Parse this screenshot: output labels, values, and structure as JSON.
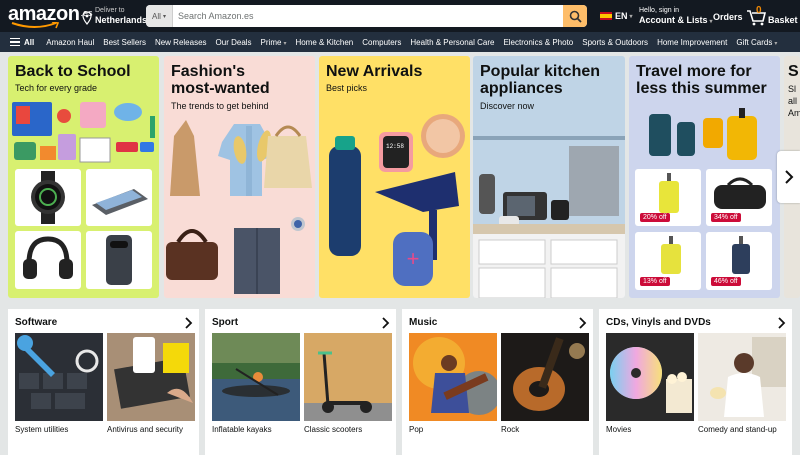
{
  "header": {
    "logo_text": "amazon",
    "logo_tld": ".es",
    "deliver_line1": "Deliver to",
    "deliver_line2": "Netherlands",
    "search_category": "All",
    "search_placeholder": "Search Amazon.es",
    "language": "EN",
    "account_line1": "Hello, sign in",
    "account_line2": "Account & Lists",
    "orders": "Orders",
    "cart_count": "0",
    "cart_label": "Basket"
  },
  "nav": {
    "all_label": "All",
    "items": [
      "Amazon Haul",
      "Best Sellers",
      "New Releases",
      "Our Deals",
      "Prime",
      "Home & Kitchen",
      "Computers",
      "Health & Personal Care",
      "Electronics & Photo",
      "Sports & Outdoors",
      "Home Improvement",
      "Gift Cards"
    ]
  },
  "hero": {
    "card1": {
      "title": "Back to School",
      "subtitle": "Tech for every grade"
    },
    "card2": {
      "title_line1": "Fashion's",
      "title_line2": "most-wanted",
      "subtitle": "The trends to get behind"
    },
    "card3": {
      "title": "New Arrivals",
      "subtitle": "Best picks"
    },
    "card4": {
      "title_line1": "Popular kitchen",
      "title_line2": "appliances",
      "subtitle": "Discover now"
    },
    "card5": {
      "title_line1": "Travel more for",
      "title_line2": "less this summer",
      "badges": [
        "20% off",
        "34% off",
        "13% off",
        "46% off"
      ]
    },
    "card6": {
      "title_partial": "S",
      "subtitle_partial_1": "Sl",
      "subtitle_partial_2": "all",
      "subtitle_partial_3": "Am"
    }
  },
  "watch_time": "12:58",
  "categories": [
    {
      "title": "Software",
      "items": [
        "System utilities",
        "Antivirus and security"
      ]
    },
    {
      "title": "Sport",
      "items": [
        "Inflatable kayaks",
        "Classic scooters"
      ]
    },
    {
      "title": "Music",
      "items": [
        "Pop",
        "Rock"
      ]
    },
    {
      "title": "CDs, Vinyls and DVDs",
      "items": [
        "Movies",
        "Comedy and stand-up"
      ]
    }
  ],
  "colors": {
    "topbar": "#131921",
    "navbar": "#232f3e",
    "search_button": "#febd69",
    "deal_badge": "#cc0c39"
  }
}
